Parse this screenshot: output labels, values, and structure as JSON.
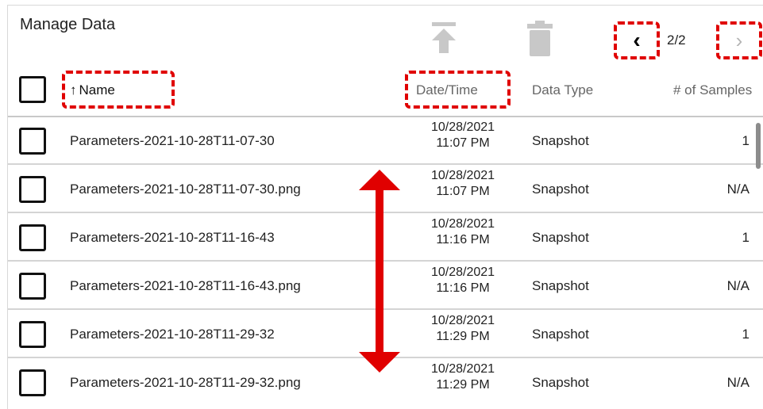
{
  "header": {
    "title": "Manage Data",
    "upload_icon": "upload-icon",
    "trash_icon": "trash-icon",
    "prev_glyph": "‹",
    "next_glyph": "›",
    "page_indicator": "2/2"
  },
  "columns": {
    "name": "Name",
    "sort_arrow": "↑",
    "date_time": "Date/Time",
    "data_type": "Data Type",
    "samples": "# of Samples"
  },
  "rows": [
    {
      "name": "Parameters-2021-10-28T11-07-30",
      "date": "10/28/2021",
      "time": "11:07 PM",
      "type": "Snapshot",
      "samples": "1"
    },
    {
      "name": "Parameters-2021-10-28T11-07-30.png",
      "date": "10/28/2021",
      "time": "11:07 PM",
      "type": "Snapshot",
      "samples": "N/A"
    },
    {
      "name": "Parameters-2021-10-28T11-16-43",
      "date": "10/28/2021",
      "time": "11:16 PM",
      "type": "Snapshot",
      "samples": "1"
    },
    {
      "name": "Parameters-2021-10-28T11-16-43.png",
      "date": "10/28/2021",
      "time": "11:16 PM",
      "type": "Snapshot",
      "samples": "N/A"
    },
    {
      "name": "Parameters-2021-10-28T11-29-32",
      "date": "10/28/2021",
      "time": "11:29 PM",
      "type": "Snapshot",
      "samples": "1"
    },
    {
      "name": "Parameters-2021-10-28T11-29-32.png",
      "date": "10/28/2021",
      "time": "11:29 PM",
      "type": "Snapshot",
      "samples": "N/A"
    }
  ],
  "colors": {
    "annotation": "#e00000",
    "disabled_icon": "#c8c8c8"
  }
}
